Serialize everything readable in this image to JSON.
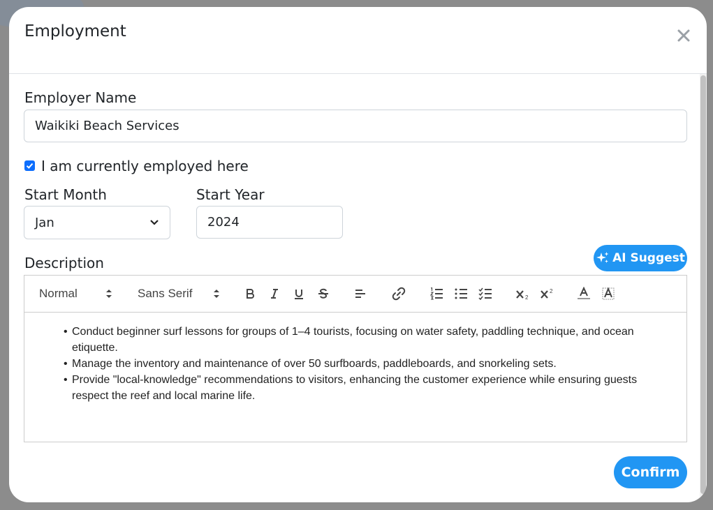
{
  "modal": {
    "title": "Employment"
  },
  "form": {
    "employer_label": "Employer Name",
    "employer_value": "Waikiki Beach Services",
    "current_label": "I am currently employed here",
    "current_checked": true,
    "start_month_label": "Start Month",
    "start_month_value": "Jan",
    "start_year_label": "Start Year",
    "start_year_value": "2024",
    "description_label": "Description",
    "ai_suggest_label": "AI Suggest"
  },
  "editor": {
    "toolbar": {
      "heading_picker": "Normal",
      "font_picker": "Sans Serif"
    },
    "bullets": [
      "Conduct beginner surf lessons for groups of 1–4 tourists, focusing on water safety, paddling technique, and ocean etiquette.",
      "Manage the inventory and maintenance of over 50 surfboards, paddleboards, and snorkeling sets.",
      "Provide \"local-knowledge\" recommendations to visitors, enhancing the customer experience while ensuring guests respect the reef and local marine life."
    ]
  },
  "actions": {
    "confirm_label": "Confirm"
  },
  "colors": {
    "accent": "#2196f3",
    "checkbox": "#0d6efd"
  }
}
